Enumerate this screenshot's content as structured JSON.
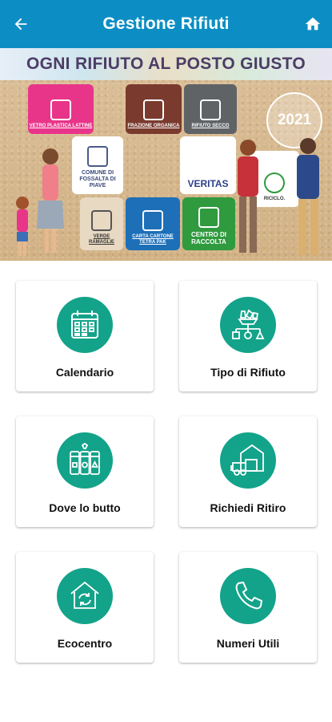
{
  "appbar": {
    "title": "Gestione Rifiuti",
    "back_icon": "arrow-left-icon",
    "home_icon": "home-icon",
    "color": "#0c8ec4"
  },
  "banner": {
    "headline": "OGNI RIFIUTO AL POSTO GIUSTO",
    "year": "2021",
    "pieces": [
      {
        "label": "VETRO PLASTICA LATTINE",
        "color": "#e8358a"
      },
      {
        "label": "FRAZIONE ORGANICA",
        "color": "#7a3b2e"
      },
      {
        "label": "RIFIUTO SECCO",
        "color": "#5f6366"
      },
      {
        "label": "COMUNE DI FOSSALTA DI PIAVE",
        "color": "#ffffff"
      },
      {
        "label": "VERITAS",
        "color": "#ffffff"
      },
      {
        "label": "VERDE RAMAGLIE",
        "color": "#e8d9c2"
      },
      {
        "label": "CARTA CARTONE TETRA PAK",
        "color": "#1d6fb8"
      },
      {
        "label": "CENTRO DI RACCOLTA",
        "color": "#2f9a3e"
      },
      {
        "label": "RICICLO.",
        "color": "#ffffff"
      }
    ]
  },
  "menu": {
    "accent": "#13a38a",
    "items": [
      {
        "label": "Calendario",
        "icon": "calendar-icon"
      },
      {
        "label": "Tipo di Rifiuto",
        "icon": "waste-sorting-icon"
      },
      {
        "label": "Dove lo butto",
        "icon": "waste-bins-icon"
      },
      {
        "label": "Richiedi Ritiro",
        "icon": "pickup-truck-icon"
      },
      {
        "label": "Ecocentro",
        "icon": "recycling-house-icon"
      },
      {
        "label": "Numeri Utili",
        "icon": "phone-icon"
      }
    ]
  }
}
